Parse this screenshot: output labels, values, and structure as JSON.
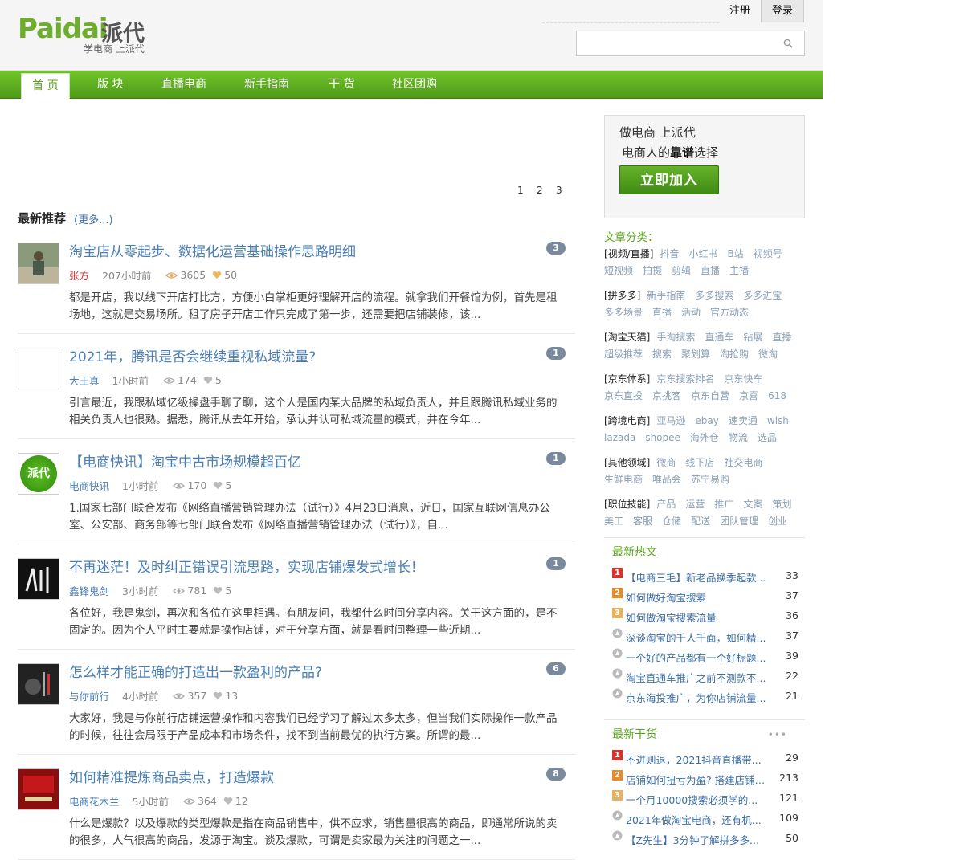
{
  "logo": {
    "en": "Paidai",
    "cn": "派代",
    "slogan": "学电商 上派代"
  },
  "top": {
    "register": "注册",
    "login": "登录",
    "search_placeholder": ""
  },
  "nav": [
    {
      "label": "首 页",
      "active": true
    },
    {
      "label": "版 块"
    },
    {
      "label": "直播电商"
    },
    {
      "label": "新手指南"
    },
    {
      "label": "干 货"
    },
    {
      "label": "社区团购"
    }
  ],
  "pager": [
    "1",
    "2",
    "3"
  ],
  "latest": {
    "title": "最新推荐",
    "more": "(更多...)"
  },
  "articles": [
    {
      "title": "淘宝店从零起步、数据化运营基础操作思路明细",
      "author": "张方",
      "author_red": true,
      "time": "207小时前",
      "views": "3605",
      "likes": "50",
      "badge": "3",
      "avatar": "person",
      "excerpt": "都是开店，我以线下开店打比方，方便小白掌柜更好理解开店的流程。就拿我们开餐馆为例，首先是租场地，这就是交易场所。租了房子开店工作只完成了第一步，还需要把店铺装修，该..."
    },
    {
      "title": "2021年，腾讯是否会继续重视私域流量?",
      "author": "大王真",
      "author_red": false,
      "time": "1小时前",
      "views": "174",
      "likes": "5",
      "badge": "1",
      "avatar": "blank",
      "excerpt": "引言最近，我跟私域亿级操盘手聊了聊，这个人是国内某大品牌的私域负责人，并且跟腾讯私域业务的相关负责人也很熟。据悉，腾讯从去年开始，承认并认可私域流量的模式，并在今年..."
    },
    {
      "title": "【电商快讯】淘宝中古市场规模超百亿",
      "author": "电商快讯",
      "author_red": false,
      "time": "1小时前",
      "views": "170",
      "likes": "5",
      "badge": "1",
      "avatar": "paidai",
      "avatar_text": "派代",
      "excerpt": "1.国家七部门联合发布《网络直播营销管理办法（试行）》4月23日消息，近日，国家互联网信息办公室、公安部、商务部等七部门联合发布《网络直播营销管理办法（试行）》，自..."
    },
    {
      "title": "不再迷茫！及时纠正错误引流思路，实现店铺爆发式增长！",
      "author": "鑫锋鬼剑",
      "author_red": false,
      "time": "3小时前",
      "views": "781",
      "likes": "5",
      "badge": "1",
      "avatar": "sword",
      "excerpt": "各位好，我是鬼剑，再次和各位在这里相遇。有朋友问，我都什么时间分享内容。关于这方面的，是不固定的。因为个人平时主要就是操作店铺，对于分享方面，就是看时间整理一些近期..."
    },
    {
      "title": "怎么样才能正确的打造出一款盈利的产品?",
      "author": "与你前行",
      "author_red": false,
      "time": "4小时前",
      "views": "357",
      "likes": "13",
      "badge": "6",
      "avatar": "dark",
      "excerpt": "大家好，我是与你前行店铺运营操作和内容我们已经学习了解过太多太多，但当我们实际操作一款产品的时候，往往会局限于产品成本和市场条件，找不到当前最优的执行方案。所谓的最..."
    },
    {
      "title": "如何精准提炼商品卖点，打造爆款",
      "author": "电商花木兰",
      "author_red": false,
      "time": "5小时前",
      "views": "364",
      "likes": "12",
      "badge": "8",
      "avatar": "red",
      "excerpt": "什么是爆款？以及爆款的类型爆款是指在商品销售中，供不应求，销售量很高的商品，即通常所说的卖的很多，人气很高的商品，发源于淘宝。谈及爆款，可谓是卖家最为关注的问题之一..."
    }
  ],
  "join": {
    "line1": "做电商 上派代",
    "line2_pre": "电商人的",
    "line2_bold": "靠谱",
    "line2_post": "选择",
    "button": "立即加入"
  },
  "categories": {
    "title": "文章分类：",
    "rows": [
      {
        "head": "[视频/直播]",
        "items": [
          "抖音",
          "小红书",
          "B站",
          "视频号"
        ]
      },
      {
        "items": [
          "短视频",
          "拍摄",
          "剪辑",
          "直播",
          "主播"
        ]
      },
      {
        "head": "[拼多多]",
        "items": [
          "新手指南",
          "多多搜索",
          "多多进宝"
        ]
      },
      {
        "items": [
          "多多场景",
          "直播",
          "活动",
          "官方动态"
        ]
      },
      {
        "head": "[淘宝天猫]",
        "items": [
          "手淘搜索",
          "直通车",
          "钻展",
          "直播"
        ]
      },
      {
        "items": [
          "超级推荐",
          "搜索",
          "聚划算",
          "淘抢购",
          "微淘"
        ]
      },
      {
        "head": "[京东体系]",
        "items": [
          "京东搜索排名",
          "京东快车"
        ]
      },
      {
        "items": [
          "京东直投",
          "京挑客",
          "京东自营",
          "京喜",
          "618"
        ]
      },
      {
        "head": "[跨境电商]",
        "items": [
          "亚马逊",
          "ebay",
          "速卖通",
          "wish"
        ]
      },
      {
        "items": [
          "lazada",
          "shopee",
          "海外仓",
          "物流",
          "选品"
        ]
      },
      {
        "head": "[其他领域]",
        "items": [
          "微商",
          "线下店",
          "社交电商"
        ]
      },
      {
        "items": [
          "生鲜电商",
          "唯品会",
          "苏宁易购"
        ]
      },
      {
        "head": "[职位技能]",
        "items": [
          "产品",
          "运营",
          "推广",
          "文案",
          "策划"
        ]
      },
      {
        "items": [
          "美工",
          "客服",
          "仓储",
          "配送",
          "团队管理",
          "创业"
        ]
      }
    ]
  },
  "hot": {
    "title": "最新热文",
    "items": [
      {
        "rank": "1",
        "text": "【电商三毛】新老品换季起款...",
        "num": "33"
      },
      {
        "rank": "2",
        "text": "如何做好淘宝搜索",
        "num": "37"
      },
      {
        "rank": "3",
        "text": "如何做淘宝搜索流量",
        "num": "36"
      },
      {
        "rank": "4",
        "text": "深谈淘宝的千人千面，如何精...",
        "num": "37"
      },
      {
        "rank": "5",
        "text": "一个好的产品都有一个好标题...",
        "num": "39"
      },
      {
        "rank": "6",
        "text": "淘宝直通车推广之前不测款不...",
        "num": "22"
      },
      {
        "rank": "7",
        "text": "京东海投推广，为你店铺流量...",
        "num": "21"
      }
    ]
  },
  "dry": {
    "title": "最新干货",
    "more": "•••",
    "items": [
      {
        "rank": "1",
        "text": "不进则退，2021抖音直播带...",
        "num": "29"
      },
      {
        "rank": "2",
        "text": "店铺如何扭亏为盈? 搭建店铺全...",
        "num": "213"
      },
      {
        "rank": "3",
        "text": "一个月10000搜索必须学的...",
        "num": "121"
      },
      {
        "rank": "4",
        "text": "2021年做淘宝电商，还有机...",
        "num": "109"
      },
      {
        "rank": "5",
        "text": "【Z先生】3分钟了解拼多多...",
        "num": "50"
      }
    ]
  }
}
